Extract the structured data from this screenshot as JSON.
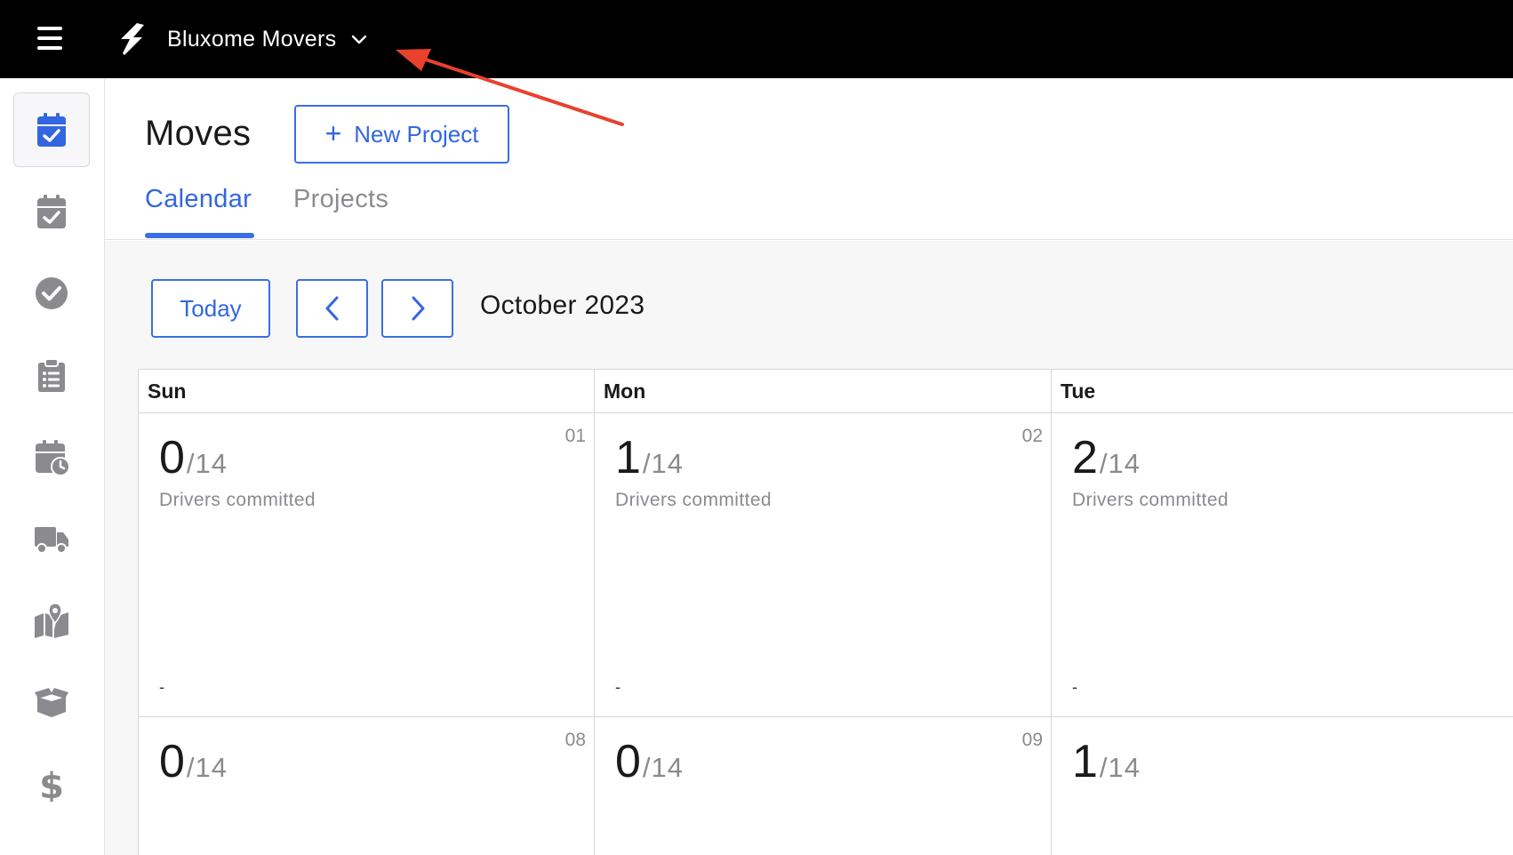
{
  "topbar": {
    "org_name": "Bluxome Movers",
    "icons": {
      "menu": "hamburger-icon",
      "logo": "lightning-bolt-logo",
      "org_dropdown": "chevron-down-icon"
    }
  },
  "sidebar": {
    "items": [
      {
        "id": "moves",
        "icon": "calendar-check-icon",
        "active": true
      },
      {
        "id": "schedule",
        "icon": "calendar-check-icon",
        "active": false
      },
      {
        "id": "tasks",
        "icon": "check-circle-icon",
        "active": false
      },
      {
        "id": "checklists",
        "icon": "clipboard-list-icon",
        "active": false
      },
      {
        "id": "availability",
        "icon": "calendar-clock-icon",
        "active": false
      },
      {
        "id": "trucks",
        "icon": "truck-icon",
        "active": false
      },
      {
        "id": "territories",
        "icon": "map-pin-icon",
        "active": false
      },
      {
        "id": "inventory",
        "icon": "box-icon",
        "active": false
      },
      {
        "id": "billing",
        "icon": "dollar-icon",
        "active": false
      }
    ]
  },
  "header": {
    "title": "Moves",
    "new_project_label": "New Project",
    "new_project_plus": "+",
    "tabs": [
      {
        "label": "Calendar",
        "active": true
      },
      {
        "label": "Projects",
        "active": false
      }
    ]
  },
  "calendar_nav": {
    "today_label": "Today",
    "month_label": "October 2023",
    "icons": {
      "prev": "chevron-left-icon",
      "next": "chevron-right-icon"
    }
  },
  "calendar": {
    "day_headers": [
      "Sun",
      "Mon",
      "Tue"
    ],
    "rows": [
      [
        {
          "date": "01",
          "committed": "0",
          "total": "/14",
          "caption": "Drivers committed",
          "footer": "-"
        },
        {
          "date": "02",
          "committed": "1",
          "total": "/14",
          "caption": "Drivers committed",
          "footer": "-"
        },
        {
          "date": "",
          "committed": "2",
          "total": "/14",
          "caption": "Drivers committed",
          "footer": "-"
        }
      ],
      [
        {
          "date": "08",
          "committed": "0",
          "total": "/14"
        },
        {
          "date": "09",
          "committed": "0",
          "total": "/14"
        },
        {
          "date": "",
          "committed": "1",
          "total": "/14"
        }
      ]
    ]
  },
  "colors": {
    "topbar_bg": "#000000",
    "accent": "#3366e0",
    "muted_text": "#8a8a90",
    "annotation_arrow": "#e8412c"
  }
}
